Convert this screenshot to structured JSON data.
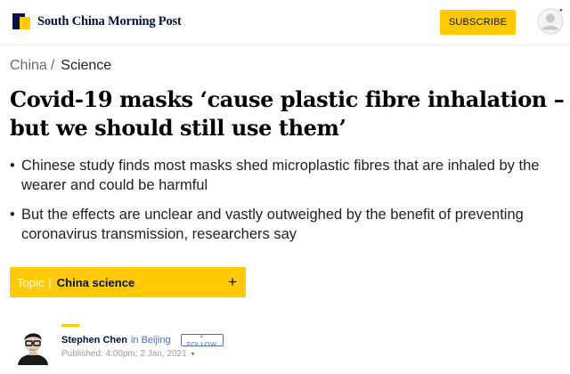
{
  "header": {
    "brand": "South China Morning Post",
    "subscribe_label": "SUBSCRIBE",
    "brand_colors": {
      "navy": "#001246",
      "yellow": "#ffca05"
    }
  },
  "breadcrumb": {
    "items": [
      "China",
      "Science"
    ],
    "separator": "/"
  },
  "article": {
    "headline": "Covid-19 masks ‘cause plastic fibre inhalation – but we should still use them’",
    "summary": [
      "Chinese study finds most masks shed microplastic fibres that are inhaled by the wearer and could be harmful",
      "But the effects are unclear and vastly outweighed by the benefit of preventing coronavirus transmission, researchers say"
    ],
    "bullet": "•"
  },
  "topic": {
    "label": "Topic",
    "separator": "|",
    "name": "China science",
    "expand_glyph": "+"
  },
  "author": {
    "name": "Stephen Chen",
    "location": "in Beijing",
    "follow_label": "+ FOLLOW",
    "published": "Published: 4:00pm, 2 Jan, 2021",
    "caret": "▾"
  },
  "icons": {
    "user": "user-avatar-icon",
    "notification": "notification-dot-icon",
    "logo": "scmp-logo-icon"
  }
}
